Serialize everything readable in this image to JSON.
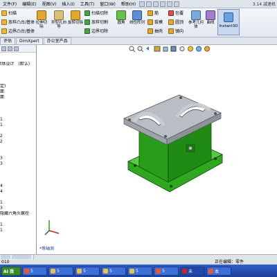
{
  "menu": {
    "items": [
      "文件(F)",
      "编辑(E)",
      "视图(V)",
      "插入(I)",
      "工具(T)",
      "窗口(W)",
      "帮助(H)"
    ],
    "title": "3.14 减速机"
  },
  "ribbon": {
    "left_items": [
      "扫描",
      "放样凸台/基体",
      "边界凸台/基体"
    ],
    "big_buttons": [
      "拉伸切除",
      "异型孔向导",
      "旋转切除"
    ],
    "cut_items": [
      "扫描切除",
      "放样切割",
      "边界切除"
    ],
    "fillet": "圆角",
    "pattern": "线性阵列",
    "feature_items": [
      "筋",
      "拔模",
      "抽壳"
    ],
    "feature_items2": [
      "包覆",
      "圆顶",
      "镜向"
    ],
    "ref_geometry": "参考几何体",
    "curves": "曲线",
    "instant3d": "Instant3D"
  },
  "tabs": [
    "评估",
    "DimXpert",
    "办公室产品"
  ],
  "tree": {
    "rows": [
      "t体设计",
      "(默认)",
      "定)",
      "面",
      "面",
      "1",
      "1",
      "2",
      "2",
      "3",
      "3",
      "4",
      "4",
      "1",
      "3",
      "隐藏六角头螺栓",
      "1",
      "1"
    ]
  },
  "viewport": {
    "view_label": "*等轴测",
    "accent_green": "#2fa81f",
    "metal_grey": "#b9bec4"
  },
  "status": {
    "left": "010",
    "right": "正在编辑：零件"
  },
  "taskbar": {
    "start_label": "AI 我",
    "tasks": [
      "5",
      "5",
      "5",
      "5",
      "5",
      "5",
      "未",
      "本"
    ]
  }
}
